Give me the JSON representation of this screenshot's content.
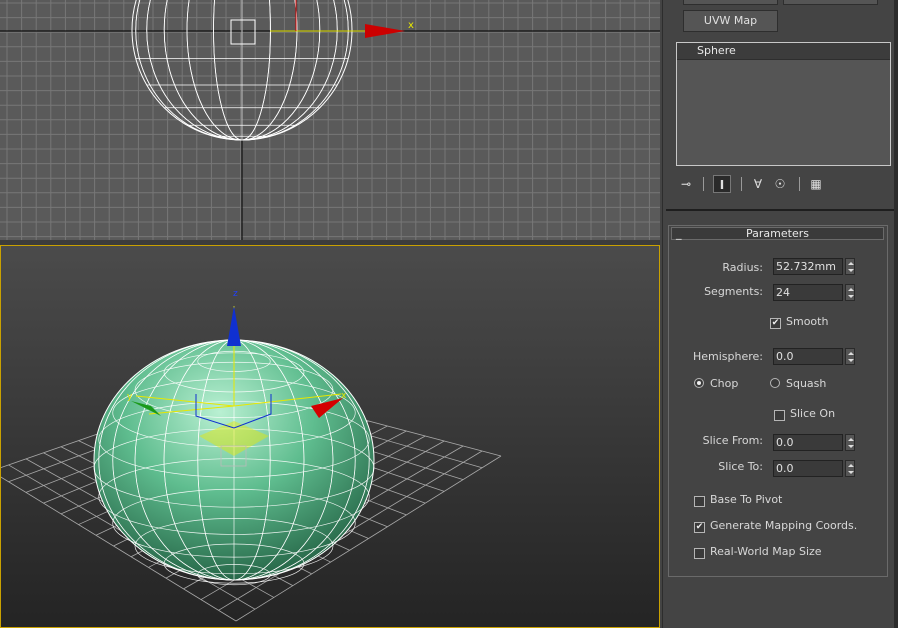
{
  "top_viewport": {
    "axis_x_label": "x"
  },
  "persp_viewport": {
    "axis_x_label": "x",
    "axis_y_label": "y",
    "axis_z_label": "z"
  },
  "command_panel": {
    "modifier_button": "UVW Map",
    "modifier_stack": [
      "Sphere"
    ],
    "toolbar_icons": [
      "pin-stack-icon",
      "show-end-result-icon",
      "make-unique-icon",
      "remove-modifier-icon",
      "configure-sets-icon"
    ],
    "rollout": {
      "title": "Parameters",
      "collapse_symbol": "_",
      "radius_label": "Radius:",
      "radius_value": "52.732mm",
      "segments_label": "Segments:",
      "segments_value": "24",
      "smooth_label": "Smooth",
      "smooth_checked": true,
      "hemisphere_label": "Hemisphere:",
      "hemisphere_value": "0.0",
      "chop_label": "Chop",
      "squash_label": "Squash",
      "selected_mode": "Chop",
      "slice_on_label": "Slice On",
      "slice_on_checked": false,
      "slice_from_label": "Slice From:",
      "slice_from_value": "0.0",
      "slice_to_label": "Slice To:",
      "slice_to_value": "0.0",
      "base_to_pivot_label": "Base To Pivot",
      "base_to_pivot_checked": false,
      "generate_mapping_label": "Generate Mapping Coords.",
      "generate_mapping_checked": true,
      "real_world_label": "Real-World Map Size",
      "real_world_checked": false
    }
  },
  "colors": {
    "sphere": "#5bb98a",
    "wire": "#ffffff",
    "axis_x": "#d40000",
    "axis_y": "#1a9a1a",
    "axis_z": "#1030d0",
    "active_border": "#c9a100"
  }
}
